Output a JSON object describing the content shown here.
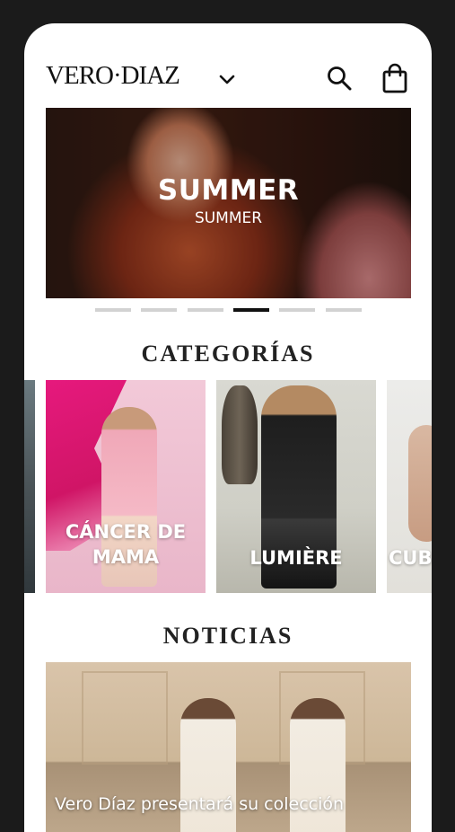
{
  "header": {
    "logo": "VERO·DIAZ",
    "icons": [
      "chevron-down-icon",
      "search-icon",
      "shopping-bag-icon"
    ]
  },
  "hero": {
    "title": "SUMMER",
    "subtitle": "SUMMER",
    "slides_total": 6,
    "active_slide": 4
  },
  "categories": {
    "title": "CATEGORÍAS",
    "items": [
      {
        "label": "CÁNCER DE\nMAMA"
      },
      {
        "label": "LUMIÈRE"
      },
      {
        "label": "CUB"
      }
    ]
  },
  "news": {
    "title": "NOTICIAS",
    "items": [
      {
        "headline": "Vero Díaz presentará su colección"
      }
    ]
  },
  "colors": {
    "background": "#ffffff",
    "frame": "#1b1b1b",
    "text": "#111111",
    "dot_active": "#111111",
    "dot_inactive": "#d2d2d2"
  }
}
